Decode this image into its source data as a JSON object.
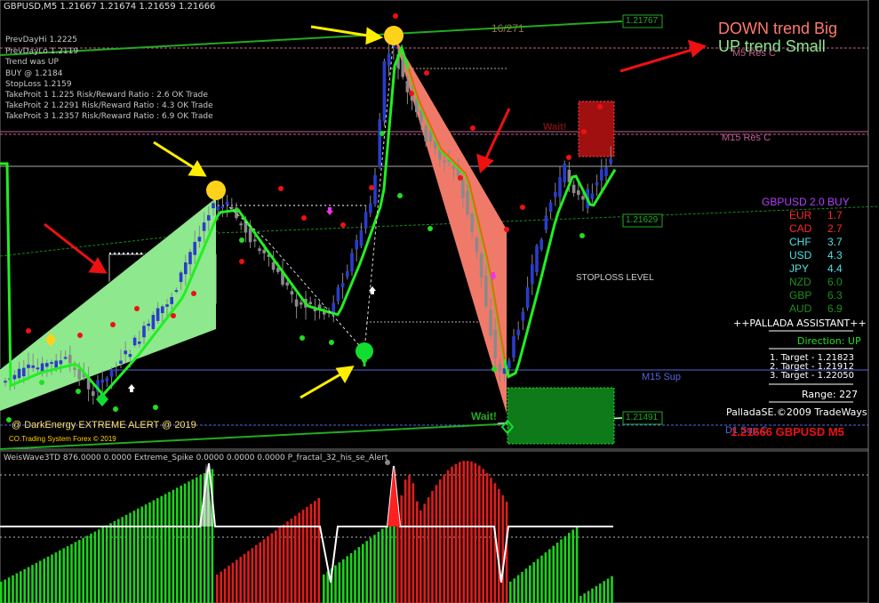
{
  "header": {
    "title": "GBPUSD,M5  1.21667 1.21674 1.21659 1.21666"
  },
  "info_lines": [
    "PrevDayHi 1.2225",
    "PrevDayLo 1.2119",
    "Trend was UP",
    "BUY @ 1.2184",
    "StopLoss 1.2159",
    "TakeProit 1 1.225 Risk/Reward Ratio : 2.6 OK Trade",
    "TakeProit 2 1.2291 Risk/Reward Ratio : 4.3 OK Trade",
    "TakeProit 3 1.2357 Risk/Reward Ratio : 6.9 OK Trade"
  ],
  "annotation": {
    "down_text": "DOWN trend Big",
    "up_text": "UP trend Small",
    "counter": "16/271"
  },
  "levels": {
    "m5_res": "M5 Res C",
    "m15_res": "M15 Res C",
    "m15_sup": "M15 Sup",
    "d1_sup": "D1 Sup C",
    "stoploss": "STOPLOSS LEVEL",
    "price_1": "1.21767",
    "price_2": "1.21629",
    "price_3": "1.21491"
  },
  "wait_labels": [
    "Wait!",
    "Wait!"
  ],
  "footer": {
    "alert": "@ DarkEnergy EXTREME ALERT @ 2019",
    "copyright": "CO.Trading System Forex  © 2019",
    "big_price": "1.21666 GBPUSD M5"
  },
  "currency_panel": {
    "title": "GBPUSD 2.0 BUY",
    "rows": [
      {
        "name": "EUR",
        "value": "1.7",
        "color": "#ff2a2a"
      },
      {
        "name": "CAD",
        "value": "2.7",
        "color": "#ff2a2a"
      },
      {
        "name": "CHF",
        "value": "3.7",
        "color": "#4fe0e0"
      },
      {
        "name": "USD",
        "value": "4.3",
        "color": "#4fe0e0"
      },
      {
        "name": "JPY",
        "value": "4.4",
        "color": "#4fe0e0"
      },
      {
        "name": "NZD",
        "value": "6.0",
        "color": "#1d8f1d"
      },
      {
        "name": "GBP",
        "value": "6.3",
        "color": "#1d8f1d"
      },
      {
        "name": "AUD",
        "value": "6.9",
        "color": "#1d8f1d"
      }
    ],
    "title_color": "#b040ff"
  },
  "palladas": {
    "title": "++PALLADA ASSISTANT++",
    "direction": "Direction: UP",
    "targets": [
      "1. Target - 1.21823",
      "2. Target - 1.21912",
      "3. Target - 1.22050"
    ],
    "range": "Range: 227",
    "credit": "PalladaSE.©2009 TradeWays"
  },
  "indicator": {
    "title": "WeisWave3TD 876.0000 0.0000   Extreme_Spike 0.0000 0.0000 0.0000   P_fractal_32_his_se_Alert"
  },
  "colors": {
    "bull": "#1fd01f",
    "bear": "#e01c1c",
    "up_zone": "#8ee88e",
    "down_zone": "#f08070",
    "ma": "#22ee22",
    "level_blue": "#5566dd",
    "level_pink": "#c06090"
  }
}
